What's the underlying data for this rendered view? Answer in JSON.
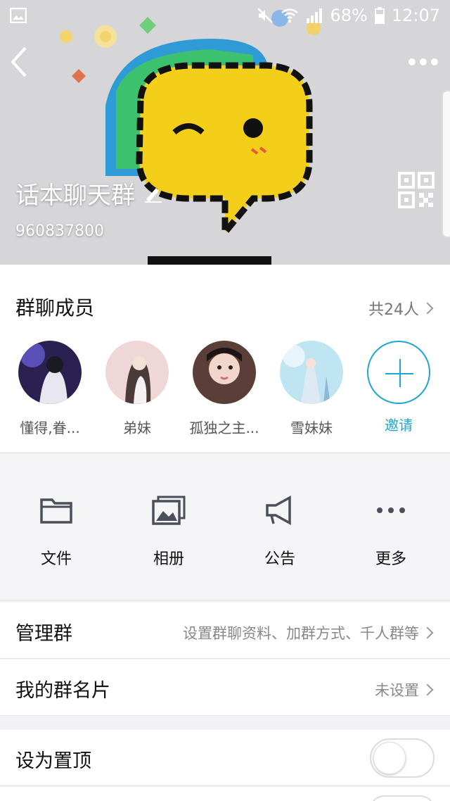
{
  "status_bar": {
    "battery": "68%",
    "time": "12:07"
  },
  "header": {
    "group_name": "话本聊天群",
    "group_id": "960837800"
  },
  "members": {
    "title": "群聊成员",
    "count": "共24人",
    "items": [
      {
        "name": "懂得,眷..."
      },
      {
        "name": "弟妹"
      },
      {
        "name": "孤独之主..."
      },
      {
        "name": "雪妹妹"
      }
    ],
    "invite_label": "邀请"
  },
  "tools": [
    {
      "label": "文件",
      "icon": "folder-icon"
    },
    {
      "label": "相册",
      "icon": "album-icon"
    },
    {
      "label": "公告",
      "icon": "megaphone-icon"
    },
    {
      "label": "更多",
      "icon": "more-icon"
    }
  ],
  "settings": {
    "manage": {
      "label": "管理群",
      "value": "设置群聊资料、加群方式、千人群等"
    },
    "card": {
      "label": "我的群名片",
      "value": "未设置"
    },
    "pin": {
      "label": "设为置顶",
      "on": false
    }
  },
  "colors": {
    "accent": "#1fa6d2"
  }
}
